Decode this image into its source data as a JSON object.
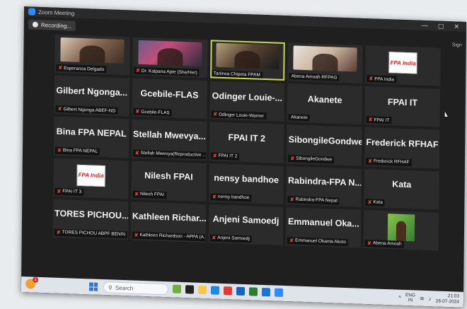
{
  "window": {
    "title": "Zoom Meeting",
    "recording_label": "Recording...",
    "sign_text": "Sign"
  },
  "participants": [
    {
      "display": "video",
      "video_theme": "v1",
      "label": "Esperanza Delgado",
      "muted": true
    },
    {
      "display": "video",
      "video_theme": "v2",
      "label": "Dr. Kalpana Apte (She/Her)",
      "muted": true
    },
    {
      "display": "video",
      "video_theme": "v3",
      "label": "Tariirwa Chipeta FPAM",
      "muted": false,
      "active": true
    },
    {
      "display": "video",
      "video_theme": "v4",
      "label": "Abena Amoah-RFPAG",
      "muted": false
    },
    {
      "display": "logo",
      "logo_text": "FPA India",
      "label": "FPA India",
      "muted": true
    },
    {
      "display": "name",
      "big": "Gilbert Ngonga...",
      "label": "Gilbert Ngonga ABEF-ND",
      "muted": true
    },
    {
      "display": "name",
      "big": "Gcebile-FLAS",
      "label": "Gcebile-FLAS",
      "muted": true
    },
    {
      "display": "name",
      "big": "Odinger Louie-...",
      "label": "Odinger Louie-Warner",
      "muted": true
    },
    {
      "display": "name",
      "big": "Akanete",
      "label": "Akanete",
      "muted": false
    },
    {
      "display": "name",
      "big": "FPAI IT",
      "label": "FPAI IT",
      "muted": true
    },
    {
      "display": "name",
      "big": "Bina FPA NEPAL",
      "label": "Bina FPA NEPAL",
      "muted": true
    },
    {
      "display": "name",
      "big": "Stellah Mwevya...",
      "label": "Stellah Mwevya(Reproductive ...",
      "muted": true
    },
    {
      "display": "name",
      "big": "FPAI IT 2",
      "label": "FPAI IT 2",
      "muted": true
    },
    {
      "display": "name",
      "big": "SibongileGondwe",
      "label": "SibongileGondwe",
      "muted": true
    },
    {
      "display": "name",
      "big": "Frederick RFHAF",
      "label": "Frederick RFHAF",
      "muted": true
    },
    {
      "display": "logo",
      "logo_text": "FPA India",
      "label": "FPAI IT 3",
      "muted": true
    },
    {
      "display": "name",
      "big": "Nilesh FPAI",
      "label": "Nilesh FPAI",
      "muted": true
    },
    {
      "display": "name",
      "big": "nensy bandhoe",
      "label": "nensy bandhoe",
      "muted": true
    },
    {
      "display": "name",
      "big": "Rabindra-FPA N...",
      "label": "Rabindra-FPA Nepal",
      "muted": true
    },
    {
      "display": "name",
      "big": "Kata",
      "label": "Kata",
      "muted": true
    },
    {
      "display": "name",
      "big": "TORES PICHOU...",
      "label": "TORES PICHOU ABPF BENIN",
      "muted": true
    },
    {
      "display": "name",
      "big": "Kathleen Richar...",
      "label": "Kathleen Richardson - APPA (A...",
      "muted": true
    },
    {
      "display": "name",
      "big": "Anjeni Samoedj",
      "label": "Anjeni Samoedj",
      "muted": true
    },
    {
      "display": "name",
      "big": "Emmanuel Oka...",
      "label": "Emmanuel Okanta Akoto",
      "muted": true
    },
    {
      "display": "photo",
      "label": "Abena Amoah",
      "muted": true
    }
  ],
  "taskbar": {
    "weather_badge": "1",
    "search_placeholder": "Search",
    "language": "ENG",
    "language_sub": "IN",
    "time": "21:03",
    "date": "28-07-2024"
  },
  "colors": {
    "active_outline": "#c8d94a",
    "mute_red": "#e0463f",
    "tile_bg": "#2b2b2b"
  }
}
